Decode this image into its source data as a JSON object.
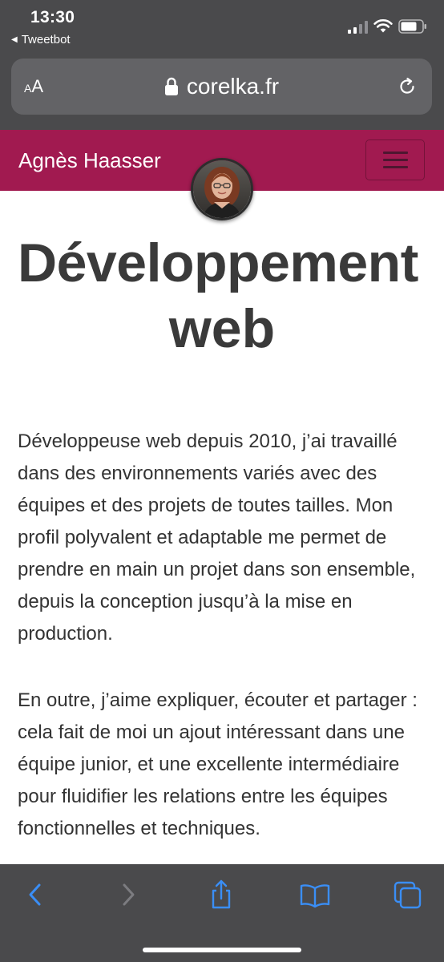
{
  "status_bar": {
    "time": "13:30",
    "back_app": "Tweetbot"
  },
  "browser": {
    "text_size_small": "A",
    "text_size_big": "A",
    "domain": "corelka.fr"
  },
  "site": {
    "brand": "Agnès Haasser",
    "headline_line1": "Développement",
    "headline_line2": "web",
    "paragraph_1": "Développeuse web depuis 2010, j’ai travaillé dans des environnements variés avec des équipes et des projets de toutes tailles. Mon profil polyvalent et adaptable me permet de prendre en main un projet dans son ensemble, depuis la conception jusqu’à la mise en production.",
    "paragraph_2": "En outre, j’aime expliquer, écouter et partager : cela fait de moi un ajout intéressant dans une équipe junior, et une excellente intermédiaire pour fluidifier les relations entre les équipes fonctionnelles et techniques."
  },
  "colors": {
    "navbar": "#a11a50",
    "chrome": "#4a4a4c",
    "toolbar_active": "#3a8ef6",
    "toolbar_disabled": "#7c7c80"
  },
  "icons": {
    "back": "chevron-left-icon",
    "forward": "chevron-right-icon",
    "share": "share-icon",
    "bookmarks": "book-icon",
    "tabs": "tabs-icon",
    "lock": "lock-icon",
    "reload": "reload-icon",
    "menu": "hamburger-icon"
  }
}
